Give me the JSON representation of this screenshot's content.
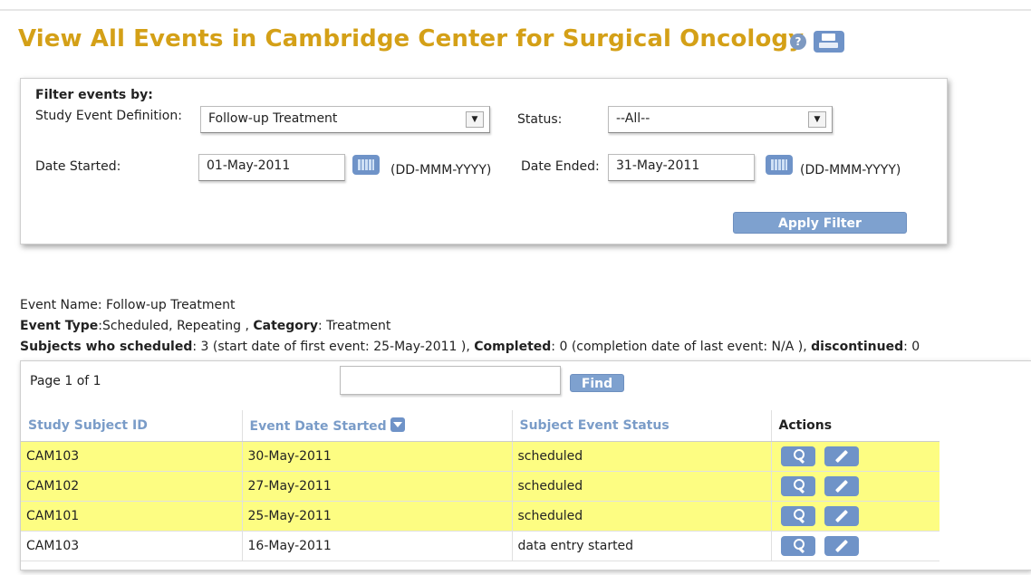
{
  "header": {
    "title": "View All Events in Cambridge Center for Surgical Oncology",
    "help_glyph": "?"
  },
  "filter": {
    "heading": "Filter events by:",
    "event_def_label": "Study Event Definition:",
    "event_def_value": "Follow-up Treatment",
    "status_label": "Status:",
    "status_value": "--All--",
    "date_started_label": "Date Started:",
    "date_started_value": "01-May-2011",
    "date_started_format": "(DD-MMM-YYYY)",
    "date_ended_label": "Date Ended:",
    "date_ended_value": "31-May-2011",
    "date_ended_format": "(DD-MMM-YYYY)",
    "apply_label": "Apply Filter",
    "select_arrow": "▼"
  },
  "event_info": {
    "name_line": "Event Name: Follow-up Treatment",
    "type_label": "Event Type",
    "type_value": ":Scheduled, Repeating , ",
    "category_label": "Category",
    "category_value": ": Treatment",
    "scheduled_label": "Subjects who scheduled",
    "scheduled_value": ": 3 (start date of first event: 25-May-2011 ), ",
    "completed_label": "Completed",
    "completed_value": ": 0 (completion date of last event: N/A ), ",
    "discontinued_label": "discontinued",
    "discontinued_value": ": 0"
  },
  "table": {
    "page_info": "Page 1 of 1",
    "search_value": "",
    "find_label": "Find",
    "headers": {
      "subject_id": "Study Subject ID",
      "event_date": "Event Date Started",
      "status": "Subject Event Status",
      "actions": "Actions"
    },
    "rows": [
      {
        "id": "CAM103",
        "date": "30-May-2011",
        "status": "scheduled"
      },
      {
        "id": "CAM102",
        "date": "27-May-2011",
        "status": "scheduled"
      },
      {
        "id": "CAM101",
        "date": "25-May-2011",
        "status": "scheduled"
      },
      {
        "id": "CAM103",
        "date": "16-May-2011",
        "status": "data entry started"
      }
    ]
  },
  "colors": {
    "title": "#d4a017",
    "link_header": "#7a9cc8",
    "button": "#7ea1cf",
    "row_highlight": "#fdfd82"
  },
  "icons": {
    "help": "help-icon",
    "print": "print-icon",
    "calendar": "calendar-icon",
    "sort": "sort-desc-icon",
    "view": "magnifier-icon",
    "edit": "pencil-icon"
  }
}
